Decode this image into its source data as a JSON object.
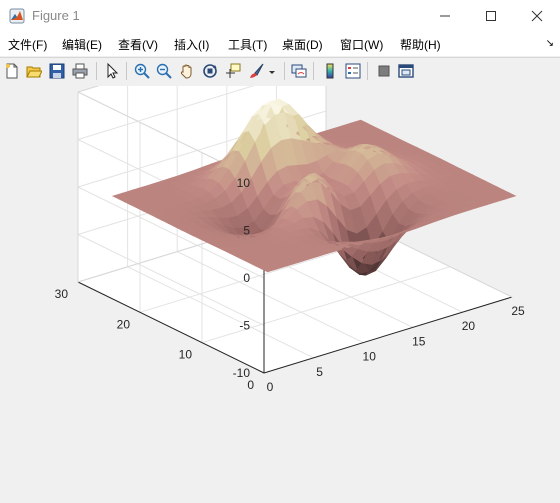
{
  "window": {
    "title": "Figure 1",
    "icon": "matlab-icon",
    "controls": [
      "minimize-icon",
      "maximize-icon",
      "close-icon"
    ]
  },
  "menu": {
    "items": [
      "文件(F)",
      "编辑(E)",
      "查看(V)",
      "插入(I)",
      "工具(T)",
      "桌面(D)",
      "窗口(W)",
      "帮助(H)"
    ],
    "overflow_arrow": "↘"
  },
  "toolbar": {
    "icons": [
      "new-figure-icon",
      "open-file-icon",
      "save-icon",
      "print-icon",
      "pointer-icon",
      "zoom-in-icon",
      "zoom-out-icon",
      "pan-icon",
      "rotate-3d-icon",
      "data-cursor-icon",
      "brush-icon",
      "link-plot-icon",
      "colorbar-icon",
      "legend-icon",
      "hide-tools-icon",
      "dock-icon"
    ]
  },
  "chart_data": {
    "type": "surface",
    "function": "peaks",
    "colormap": "pink",
    "x_ticks": [
      "0",
      "5",
      "10",
      "15",
      "20",
      "25"
    ],
    "y_ticks": [
      "0",
      "10",
      "20",
      "30"
    ],
    "z_ticks": [
      "10",
      "5",
      "0",
      "-5",
      "-10"
    ],
    "xlim": [
      0,
      25
    ],
    "ylim": [
      0,
      30
    ],
    "zlim": [
      -10,
      10
    ],
    "grid": true,
    "view": "3-D default"
  },
  "colors": {
    "surface_low": "#3c2828",
    "surface_mid": "#c38c86",
    "surface_high": "#fffff0",
    "axes_face": "#ffffff",
    "figure_bg": "#f0f0f0"
  }
}
